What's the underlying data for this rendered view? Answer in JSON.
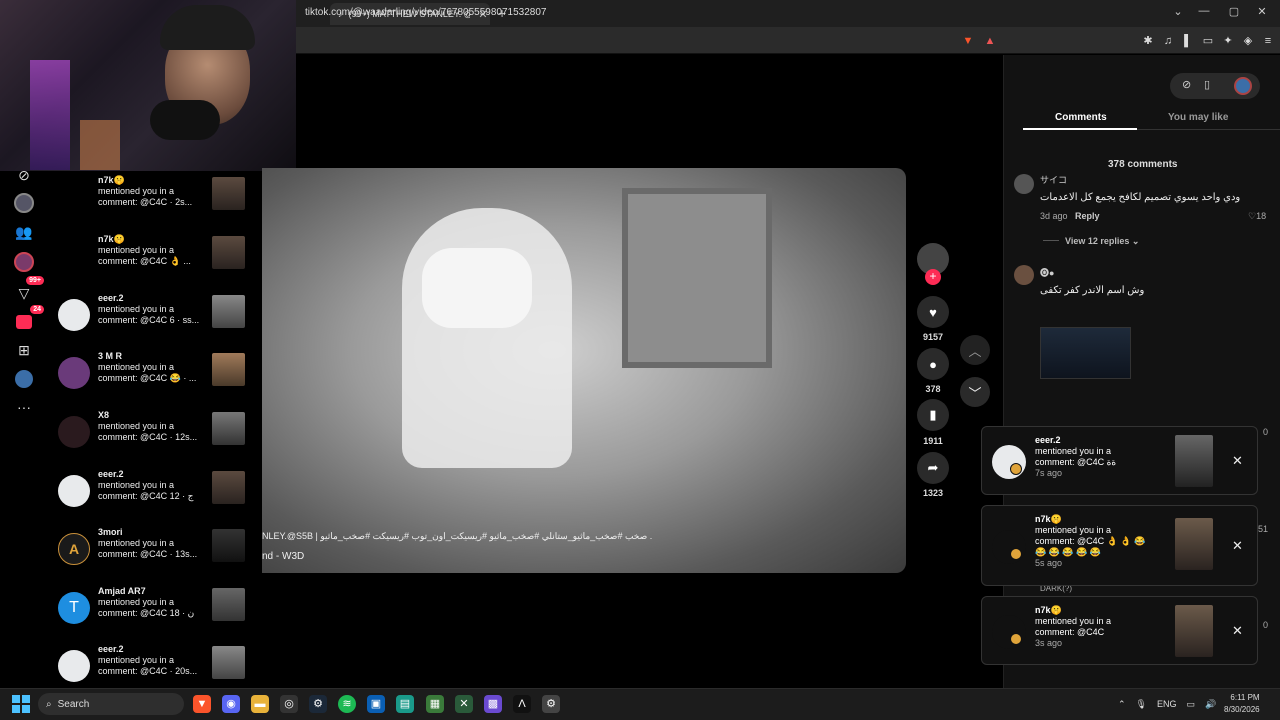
{
  "browser": {
    "tab_title": "(99+) MATTHEW STANLEY. @S5B",
    "url": "tiktok.com/@waadarling/video/7678055598071532807",
    "new_tab": "+",
    "win_minimize": "⌄",
    "win_min": "—",
    "win_max": "▢",
    "win_close": "✕"
  },
  "rail": {
    "badge_inbox": "99+",
    "badge_activity": "24",
    "more": "···"
  },
  "notifications": [
    {
      "name": "n7k🤫",
      "line1": "mentioned you in a",
      "line2": "comment: @C4C · 2s..."
    },
    {
      "name": "n7k🤫",
      "line1": "mentioned you in a",
      "line2": "comment: @C4C 👌 ..."
    },
    {
      "name": "eeer.2",
      "line1": "mentioned you in a",
      "line2": "comment: @C4C 6 · ss..."
    },
    {
      "name": "3 M R",
      "line1": "mentioned you in a",
      "line2": "comment: @C4C 😂 · ..."
    },
    {
      "name": "X8",
      "line1": "mentioned you in a",
      "line2": "comment: @C4C · 12s..."
    },
    {
      "name": "eeer.2",
      "line1": "mentioned you in a",
      "line2": "comment: @C4C 12 · ج"
    },
    {
      "name": "3mori",
      "line1": "mentioned you in a",
      "line2": "comment: @C4C · 13s..."
    },
    {
      "name": "Amjad AR7",
      "line1": "mentioned you in a",
      "line2": "comment: @C4C 18 · ن"
    },
    {
      "name": "eeer.2",
      "line1": "mentioned you in a",
      "line2": "comment: @C4C · 20s..."
    }
  ],
  "avatar_letters": {
    "a": "A",
    "t": "T"
  },
  "video": {
    "caption": "NLEY.@S5B | صخب #صخب_ماثيو_ستانلي #صخب_ماثيو #ريسيكت_اون_توب #ريسيكت #صخب_ماثيو .",
    "music": "nd - W3D",
    "likes": "9157",
    "comments": "378",
    "saves": "1911",
    "shares": "1323"
  },
  "panel": {
    "tab_comments": "Comments",
    "tab_may_like": "You may like",
    "comment_count": "378 comments",
    "c1_user": "サイコ",
    "c1_text": "ودي واحد يسوي تصميم لكافح يجمع كل الاعدمات",
    "c1_time": "3d ago",
    "c1_reply": "Reply",
    "c1_likes": "18",
    "view_replies": "View 12 replies",
    "c2_user": "🅞●",
    "c2_text": "وش اسم الاندر كفر تكفى",
    "side_zero1": "0",
    "side_51": "51",
    "side_zero2": "0",
    "dark_user": "DARK(?)"
  },
  "popups": [
    {
      "name": "eeer.2",
      "line1": "mentioned you in a",
      "line2": "comment: @C4C ةة",
      "time": "7s ago"
    },
    {
      "name": "n7k🤫",
      "line1": "mentioned you in a",
      "line2": "comment: @C4C 👌 👌 😂",
      "line3": "😂 😂 😂 😂 😂",
      "time": "5s ago"
    },
    {
      "name": "n7k🤫",
      "line1": "mentioned you in a",
      "line2": "comment: @C4C",
      "time": "3s ago"
    }
  ],
  "taskbar": {
    "search": "Search",
    "lang": "ENG",
    "time": "6:11 PM",
    "date": "8/30/2026"
  }
}
